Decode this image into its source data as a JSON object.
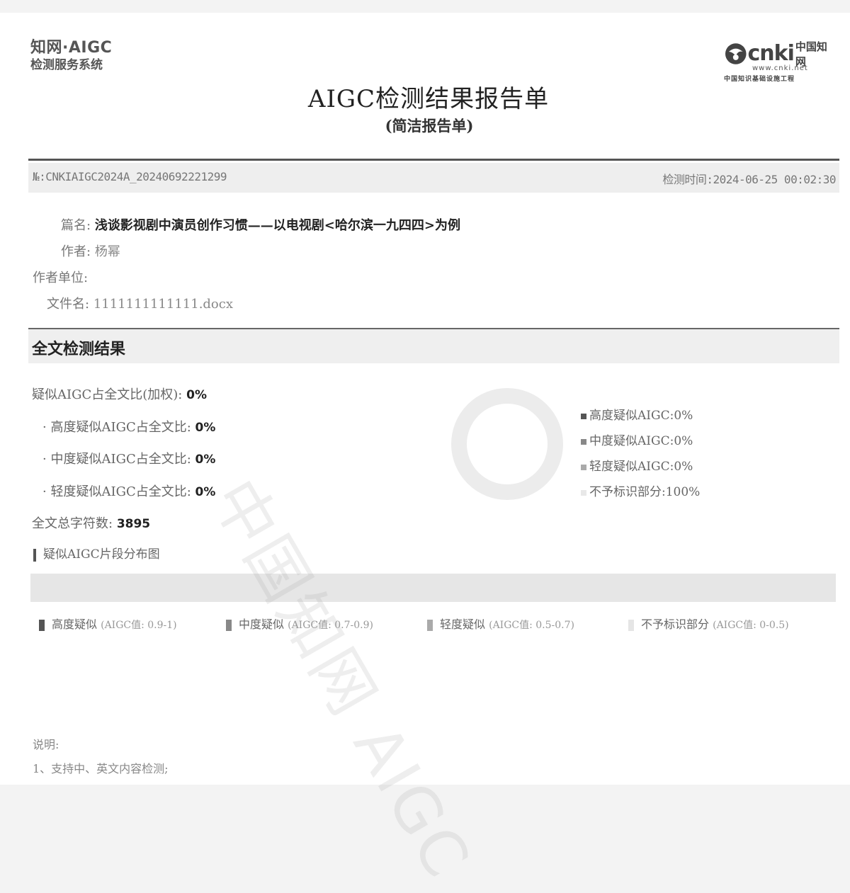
{
  "header": {
    "left_logo_line1": "知网·AIGC",
    "left_logo_line2": "检测服务系统",
    "right_logo_word": "cnki",
    "right_logo_cn": "中国知网",
    "right_logo_url": "www.cnki.net",
    "right_logo_sub": "中国知识基础设施工程"
  },
  "report": {
    "title": "AIGC检测结果报告单",
    "subtitle": "(简洁报告单)",
    "number": "№:CNKIAIGC2024A_20240692221299",
    "time_label": "检测时间:",
    "time_value": "2024-06-25 00:02:30"
  },
  "info": {
    "title_label": "篇名:",
    "title_value": "浅谈影视剧中演员创作习惯——以电视剧<哈尔滨一九四四>为例",
    "author_label": "作者:",
    "author_value": "杨幂",
    "unit_label": "作者单位:",
    "unit_value": "",
    "file_label": "文件名:",
    "file_value": "1111111111111.docx"
  },
  "results": {
    "section_title": "全文检测结果",
    "weighted_label": "疑似AIGC占全文比(加权):",
    "weighted_value": "0%",
    "high_label": "高度疑似AIGC占全文比:",
    "high_value": "0%",
    "mid_label": "中度疑似AIGC占全文比:",
    "mid_value": "0%",
    "low_label": "轻度疑似AIGC占全文比:",
    "low_value": "0%",
    "chars_label": "全文总字符数:",
    "chars_value": "3895",
    "bullet": "·"
  },
  "legend_right": [
    {
      "label": "高度疑似AIGC:",
      "value": "0%",
      "color": "#555555"
    },
    {
      "label": "中度疑似AIGC:",
      "value": "0%",
      "color": "#888888"
    },
    {
      "label": "轻度疑似AIGC:",
      "value": "0%",
      "color": "#aaaaaa"
    },
    {
      "label": "不予标识部分:",
      "value": "100%",
      "color": "#e8e8e8"
    }
  ],
  "distribution": {
    "title": "疑似AIGC片段分布图",
    "legend": [
      {
        "label": "高度疑似",
        "range": "(AIGC值: 0.9-1)",
        "color": "#555555"
      },
      {
        "label": "中度疑似",
        "range": "(AIGC值: 0.7-0.9)",
        "color": "#888888"
      },
      {
        "label": "轻度疑似",
        "range": "(AIGC值: 0.5-0.7)",
        "color": "#aaaaaa"
      },
      {
        "label": "不予标识部分",
        "range": "(AIGC值: 0-0.5)",
        "color": "#e5e5e5"
      }
    ]
  },
  "notes": {
    "heading": "说明:",
    "item1": "1、支持中、英文内容检测;"
  },
  "watermark": "中国知网 AIGC"
}
